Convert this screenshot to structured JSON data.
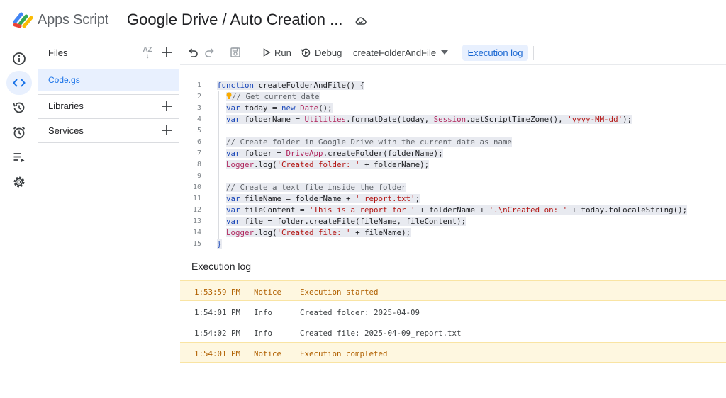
{
  "header": {
    "app_name": "Apps Script",
    "project_title": "Google Drive / Auto Creation ..."
  },
  "files_panel": {
    "files_heading": "Files",
    "files": [
      "Code.gs"
    ],
    "libraries_label": "Libraries",
    "services_label": "Services",
    "sort_label": "AZ"
  },
  "toolbar": {
    "run_label": "Run",
    "debug_label": "Debug",
    "function_select": "createFolderAndFile",
    "execution_log_label": "Execution log"
  },
  "editor": {
    "lines": [
      {
        "n": "1",
        "tokens": [
          [
            "kw",
            "function "
          ],
          [
            "fn",
            "createFolderAndFile() {"
          ]
        ]
      },
      {
        "n": "2",
        "tokens": [
          [
            "bulb",
            ""
          ],
          [
            "cm",
            "// Get current date"
          ]
        ]
      },
      {
        "n": "3",
        "tokens": [
          [
            "kw",
            "var "
          ],
          [
            "plain",
            "today = "
          ],
          [
            "kw",
            "new "
          ],
          [
            "cls",
            "Date"
          ],
          [
            "plain",
            "();"
          ]
        ]
      },
      {
        "n": "4",
        "tokens": [
          [
            "kw",
            "var "
          ],
          [
            "plain",
            "folderName = "
          ],
          [
            "cls",
            "Utilities"
          ],
          [
            "plain",
            ".formatDate(today, "
          ],
          [
            "cls",
            "Session"
          ],
          [
            "plain",
            ".getScriptTimeZone(), "
          ],
          [
            "str",
            "'yyyy-MM-dd'"
          ],
          [
            "plain",
            ");"
          ]
        ]
      },
      {
        "n": "5",
        "tokens": []
      },
      {
        "n": "6",
        "tokens": [
          [
            "cm",
            "// Create folder in Google Drive with the current date as name"
          ]
        ]
      },
      {
        "n": "7",
        "tokens": [
          [
            "kw",
            "var "
          ],
          [
            "plain",
            "folder = "
          ],
          [
            "cls",
            "DriveApp"
          ],
          [
            "plain",
            ".createFolder(folderName);"
          ]
        ]
      },
      {
        "n": "8",
        "tokens": [
          [
            "cls",
            "Logger"
          ],
          [
            "plain",
            ".log("
          ],
          [
            "str",
            "'Created folder: '"
          ],
          [
            "plain",
            " + folderName);"
          ]
        ]
      },
      {
        "n": "9",
        "tokens": []
      },
      {
        "n": "10",
        "tokens": [
          [
            "cm",
            "// Create a text file inside the folder"
          ]
        ]
      },
      {
        "n": "11",
        "tokens": [
          [
            "kw",
            "var "
          ],
          [
            "plain",
            "fileName = folderName + "
          ],
          [
            "str",
            "'_report.txt'"
          ],
          [
            "plain",
            ";"
          ]
        ]
      },
      {
        "n": "12",
        "tokens": [
          [
            "kw",
            "var "
          ],
          [
            "plain",
            "fileContent = "
          ],
          [
            "str",
            "'This is a report for '"
          ],
          [
            "plain",
            " + folderName + "
          ],
          [
            "str",
            "'.\\nCreated on: '"
          ],
          [
            "plain",
            " + today.toLocaleString();"
          ]
        ]
      },
      {
        "n": "13",
        "tokens": [
          [
            "kw",
            "var "
          ],
          [
            "plain",
            "file = folder.createFile(fileName, fileContent);"
          ]
        ]
      },
      {
        "n": "14",
        "tokens": [
          [
            "cls",
            "Logger"
          ],
          [
            "plain",
            ".log("
          ],
          [
            "str",
            "'Created file: '"
          ],
          [
            "plain",
            " + fileName);"
          ]
        ]
      },
      {
        "n": "15",
        "tokens": [
          [
            "kw",
            "}"
          ]
        ]
      }
    ]
  },
  "execution_log": {
    "title": "Execution log",
    "rows": [
      {
        "time": "1:53:59 PM",
        "severity": "Notice",
        "message": "Execution started",
        "kind": "notice"
      },
      {
        "time": "1:54:01 PM",
        "severity": "Info",
        "message": "Created folder: 2025-04-09",
        "kind": "info"
      },
      {
        "time": "1:54:02 PM",
        "severity": "Info",
        "message": "Created file: 2025-04-09_report.txt",
        "kind": "info"
      },
      {
        "time": "1:54:01 PM",
        "severity": "Notice",
        "message": "Execution completed",
        "kind": "notice"
      }
    ]
  },
  "colors": {
    "accent": "#1a73e8",
    "notice_bg": "#fef7e0",
    "notice_text": "#b06000"
  }
}
